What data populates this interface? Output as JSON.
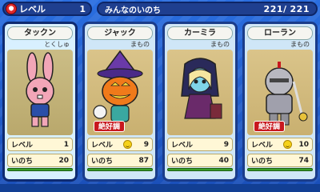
{
  "header": {
    "level_label": "レベル",
    "level_value": "1",
    "life_label": "みんなのいのち",
    "life_current": "221/",
    "life_max": "221"
  },
  "cards": [
    {
      "name": "タックン",
      "tribe": "とくしゅ",
      "badge": "",
      "level_label": "レベル",
      "level": "1",
      "life_label": "いのち",
      "life": "20",
      "mood": false
    },
    {
      "name": "ジャック",
      "tribe": "まもの",
      "badge": "絶好調",
      "level_label": "レベル",
      "level": "9",
      "life_label": "いのち",
      "life": "87",
      "mood": true
    },
    {
      "name": "カーミラ",
      "tribe": "まもの",
      "badge": "",
      "level_label": "レベル",
      "level": "9",
      "life_label": "いのち",
      "life": "40",
      "mood": false
    },
    {
      "name": "ローラン",
      "tribe": "まもの",
      "badge": "絶好調",
      "level_label": "レベル",
      "level": "10",
      "life_label": "いのち",
      "life": "74",
      "mood": true
    }
  ],
  "colors": {
    "background": "#1a56c4",
    "badge": "#c8181e",
    "hp_bar": "#3a9e2a"
  }
}
